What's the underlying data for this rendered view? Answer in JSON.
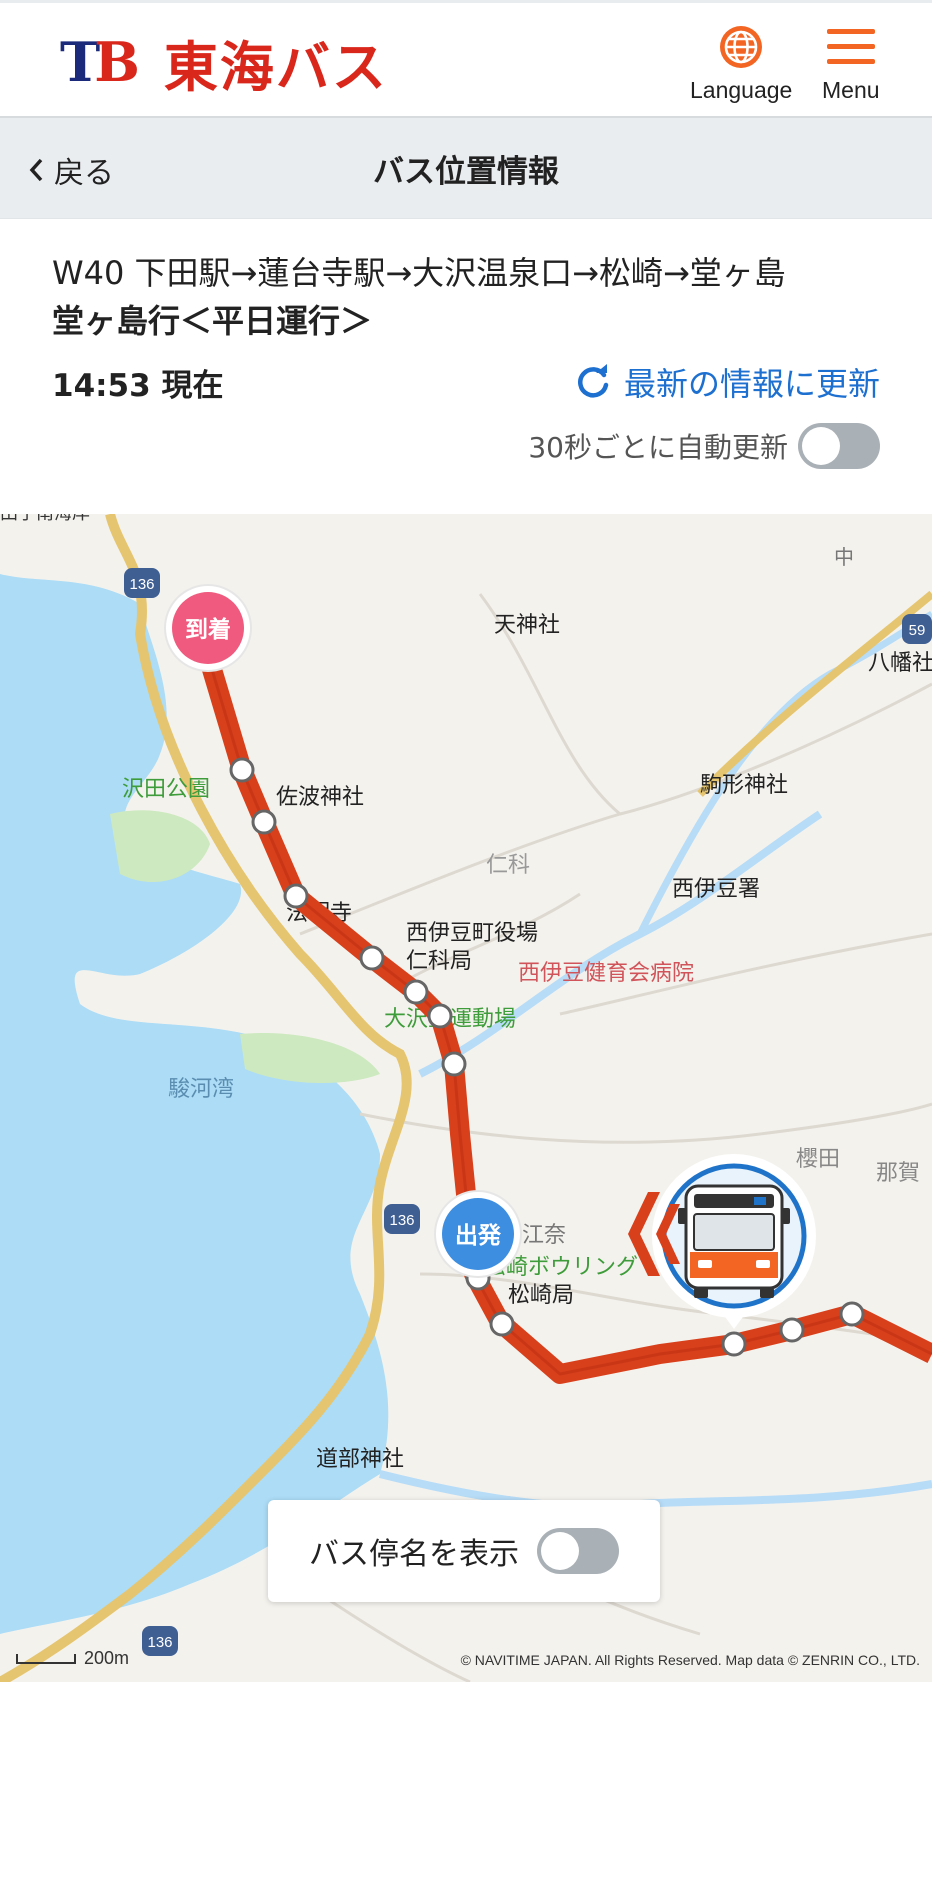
{
  "header": {
    "logo_mark": "TB",
    "logo_text": "東海バス",
    "language_label": "Language",
    "menu_label": "Menu",
    "icon_language": "globe-icon",
    "icon_menu": "hamburger-icon",
    "accent_color": "#f26522"
  },
  "nav": {
    "back_label": "戻る",
    "title": "バス位置情報"
  },
  "route": {
    "name": "W40 下田駅→蓮台寺駅→大沢温泉口→松崎→堂ヶ島",
    "destination": "堂ヶ島行＜平日運行＞",
    "time_label": "14:53 現在",
    "refresh_label": "最新の情報に更新",
    "auto_refresh_label": "30秒ごとに自動更新",
    "auto_refresh_enabled": false
  },
  "map": {
    "arrive_label": "到着",
    "depart_label": "出発",
    "place_labels": {
      "tenjinja": "天神社",
      "hachiman": "八幡社",
      "komagata": "駒形神社",
      "sawada_park": "沢田公園",
      "sawa_shrine": "佐波神社",
      "nishina": "仁科",
      "nishiizu_police": "西伊豆署",
      "hoji": "法明寺",
      "town_office": "西伊豆町役場",
      "nishina_post": "仁科局",
      "hospital": "西伊豆健育会病院",
      "sports_ground": "大沢里運動場",
      "suruga_bay": "駿河湾",
      "sakurada": "櫻田",
      "naka": "那賀",
      "ena": "江奈",
      "bowling": "松崎ボウリング",
      "matsuzaki_post": "松崎局",
      "dobu_shrine": "道部神社",
      "naka_top": "中",
      "top_left_cut": "田子南海岸"
    },
    "route_shields": [
      "136",
      "136",
      "136",
      "59"
    ],
    "show_stop_names_label": "バス停名を表示",
    "show_stop_names_enabled": false,
    "scale_label": "200m",
    "copyright": "© NAVITIME JAPAN. All Rights Reserved. Map data © ZENRIN CO., LTD.",
    "route_color": "#d8401c",
    "arrive_color": "#f05a7e",
    "depart_color": "#3d8ee0",
    "bus_icon": "bus-icon"
  }
}
